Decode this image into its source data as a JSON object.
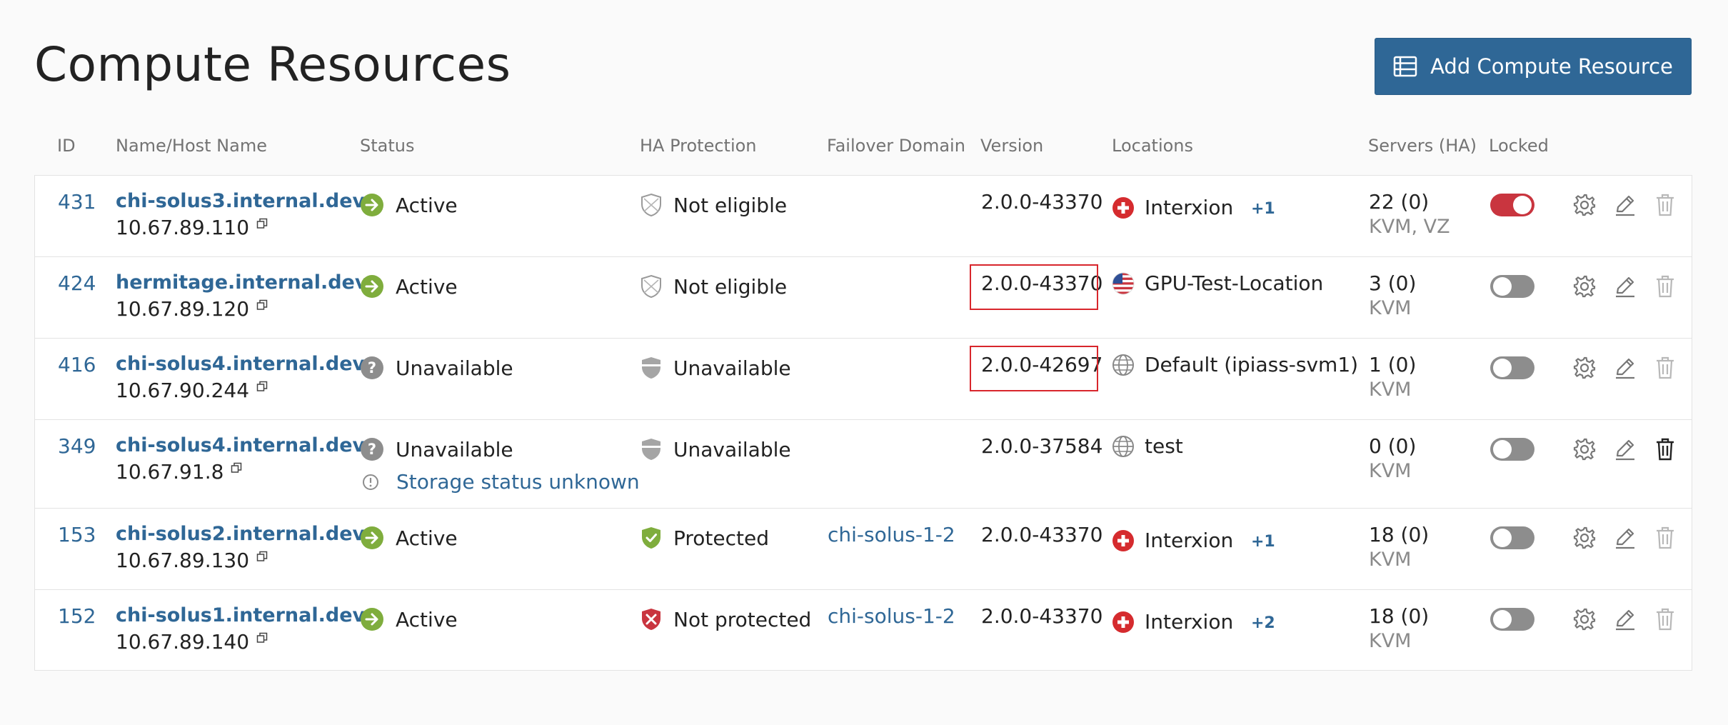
{
  "page": {
    "title": "Compute Resources"
  },
  "toolbar": {
    "add_label": "Add Compute Resource"
  },
  "columns": {
    "id": "ID",
    "name": "Name/Host Name",
    "status": "Status",
    "ha": "HA Protection",
    "failover": "Failover Domain",
    "version": "Version",
    "locations": "Locations",
    "servers": "Servers (HA)",
    "locked": "Locked"
  },
  "rows": [
    {
      "id": "431",
      "host": "chi-solus3.internal.dev",
      "ip": "10.67.89.110",
      "status": "Active",
      "status_icon": "active-arrow-icon",
      "ha": "Not eligible",
      "ha_icon": "shield-outline-x-icon",
      "failover": "",
      "version": "2.0.0-43370",
      "location": "Interxion",
      "location_icon": "swiss-flag-icon",
      "location_extra": "+1",
      "servers": "22 (0)",
      "virt": "KVM, VZ",
      "locked": true
    },
    {
      "id": "424",
      "host": "hermitage.internal.dev",
      "ip": "10.67.89.120",
      "status": "Active",
      "status_icon": "active-arrow-icon",
      "ha": "Not eligible",
      "ha_icon": "shield-outline-x-icon",
      "failover": "",
      "version": "2.0.0-43370",
      "location": "GPU-Test-Location",
      "location_icon": "us-flag-icon",
      "location_extra": "",
      "servers": "3 (0)",
      "virt": "KVM",
      "locked": false
    },
    {
      "id": "416",
      "host": "chi-solus4.internal.dev",
      "ip": "10.67.90.244",
      "status": "Unavailable",
      "status_icon": "question-icon",
      "ha": "Unavailable",
      "ha_icon": "shield-gray-icon",
      "failover": "",
      "version": "2.0.0-42697",
      "location": "Default (ipiass-svm1)",
      "location_icon": "globe-icon",
      "location_extra": "",
      "servers": "1 (0)",
      "virt": "KVM",
      "locked": false
    },
    {
      "id": "349",
      "host": "chi-solus4.internal.dev",
      "ip": "10.67.91.8",
      "status": "Unavailable",
      "status_icon": "question-icon",
      "storage_note": "Storage status unknown",
      "ha": "Unavailable",
      "ha_icon": "shield-gray-icon",
      "failover": "",
      "version": "2.0.0-37584",
      "location": "test",
      "location_icon": "globe-icon",
      "location_extra": "",
      "servers": "0 (0)",
      "virt": "KVM",
      "locked": false
    },
    {
      "id": "153",
      "host": "chi-solus2.internal.dev",
      "ip": "10.67.89.130",
      "status": "Active",
      "status_icon": "active-arrow-icon",
      "ha": "Protected",
      "ha_icon": "shield-check-icon",
      "failover": "chi-solus-1-2",
      "version": "2.0.0-43370",
      "location": "Interxion",
      "location_icon": "swiss-flag-icon",
      "location_extra": "+1",
      "servers": "18 (0)",
      "virt": "KVM",
      "locked": false
    },
    {
      "id": "152",
      "host": "chi-solus1.internal.dev",
      "ip": "10.67.89.140",
      "status": "Active",
      "status_icon": "active-arrow-icon",
      "ha": "Not protected",
      "ha_icon": "shield-red-x-icon",
      "failover": "chi-solus-1-2",
      "version": "2.0.0-43370",
      "location": "Interxion",
      "location_icon": "swiss-flag-icon",
      "location_extra": "+2",
      "servers": "18 (0)",
      "virt": "KVM",
      "locked": false
    }
  ],
  "colors": {
    "link": "#2f6796",
    "active": "#7fad3d",
    "danger": "#c9353f",
    "muted": "#8d8d8d",
    "highlight": "#d8262c"
  }
}
